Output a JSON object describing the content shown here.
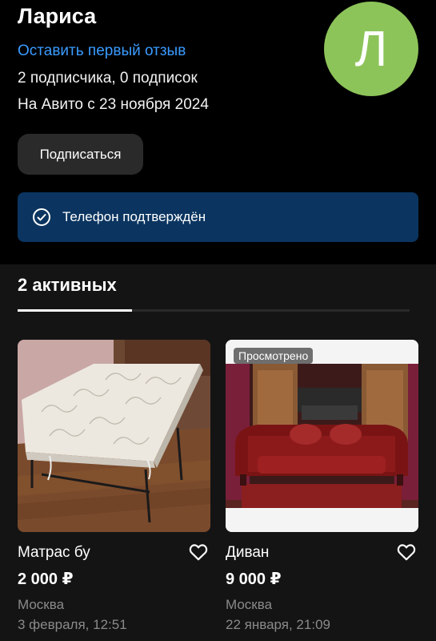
{
  "profile": {
    "name": "Лариса",
    "review_link": "Оставить первый отзыв",
    "subscribers": "2 подписчика, 0 подписок",
    "since": "На Авито с 23 ноября 2024",
    "avatar_letter": "Л",
    "subscribe_label": "Подписаться",
    "verified_text": "Телефон подтверждён"
  },
  "listings": {
    "tab_label": "2 активных",
    "items": [
      {
        "title": "Матрас бу",
        "price": "2 000 ₽",
        "city": "Москва",
        "date": "3 февраля, 12:51",
        "badge": ""
      },
      {
        "title": "Диван",
        "price": "9 000 ₽",
        "city": "Москва",
        "date": "22 января, 21:09",
        "badge": "Просмотрено"
      }
    ]
  },
  "colors": {
    "accent_link": "#3a9bff",
    "avatar_bg": "#8dc45a",
    "verified_bg": "#0b3560"
  }
}
